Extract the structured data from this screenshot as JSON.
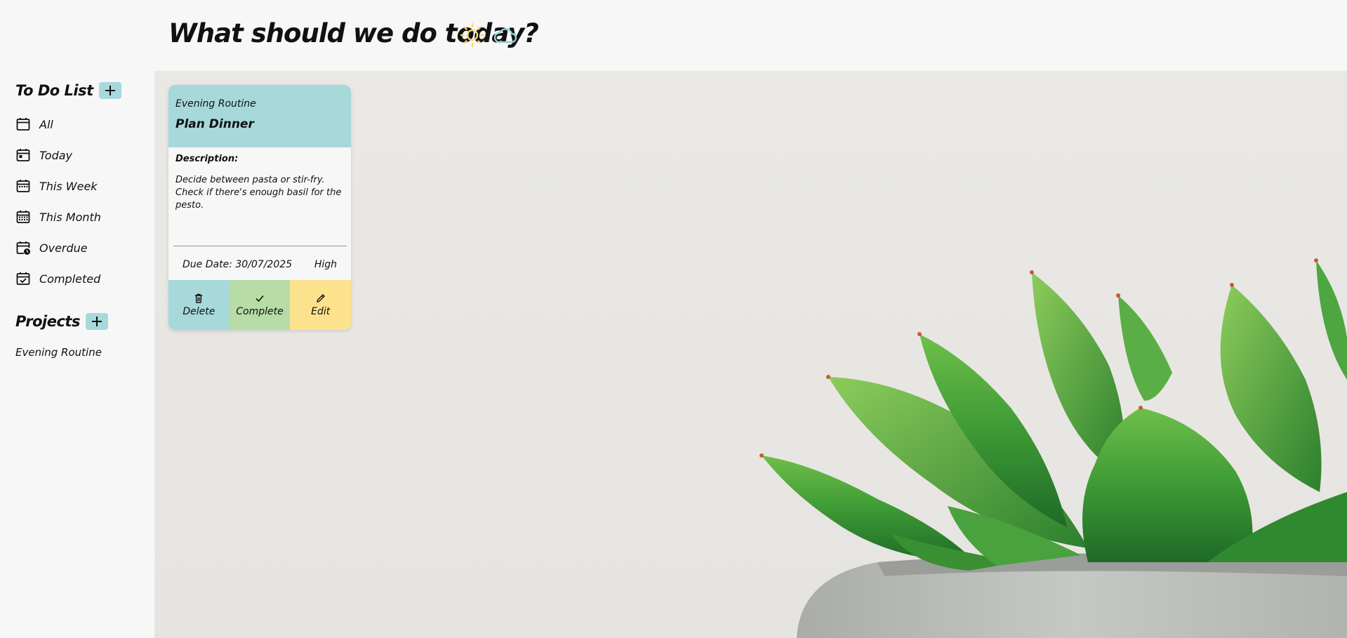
{
  "header": {
    "title": "What should we do today?",
    "sun_icon": "sun-icon",
    "cloud_icon": "cloud-icon"
  },
  "sidebar": {
    "todo_heading": "To Do List",
    "items": [
      {
        "label": "All",
        "icon": "calendar-icon"
      },
      {
        "label": "Today",
        "icon": "calendar-day-icon"
      },
      {
        "label": "This Week",
        "icon": "calendar-week-icon"
      },
      {
        "label": "This Month",
        "icon": "calendar-month-icon"
      },
      {
        "label": "Overdue",
        "icon": "calendar-clock-icon"
      },
      {
        "label": "Completed",
        "icon": "calendar-check-icon"
      }
    ],
    "projects_heading": "Projects",
    "projects": [
      "Evening Routine"
    ]
  },
  "task": {
    "project": "Evening Routine",
    "title": "Plan Dinner",
    "description_label": "Description:",
    "description": "Decide between pasta or stir-fry. Check if there's enough basil for the pesto.",
    "due_date": "Due Date: 30/07/2025",
    "priority": "High",
    "actions": {
      "delete": "Delete",
      "complete": "Complete",
      "edit": "Edit"
    }
  },
  "colors": {
    "teal": "#a7d8da",
    "green": "#b7dca6",
    "yellow": "#fde28e",
    "background": "#f7f7f7"
  }
}
